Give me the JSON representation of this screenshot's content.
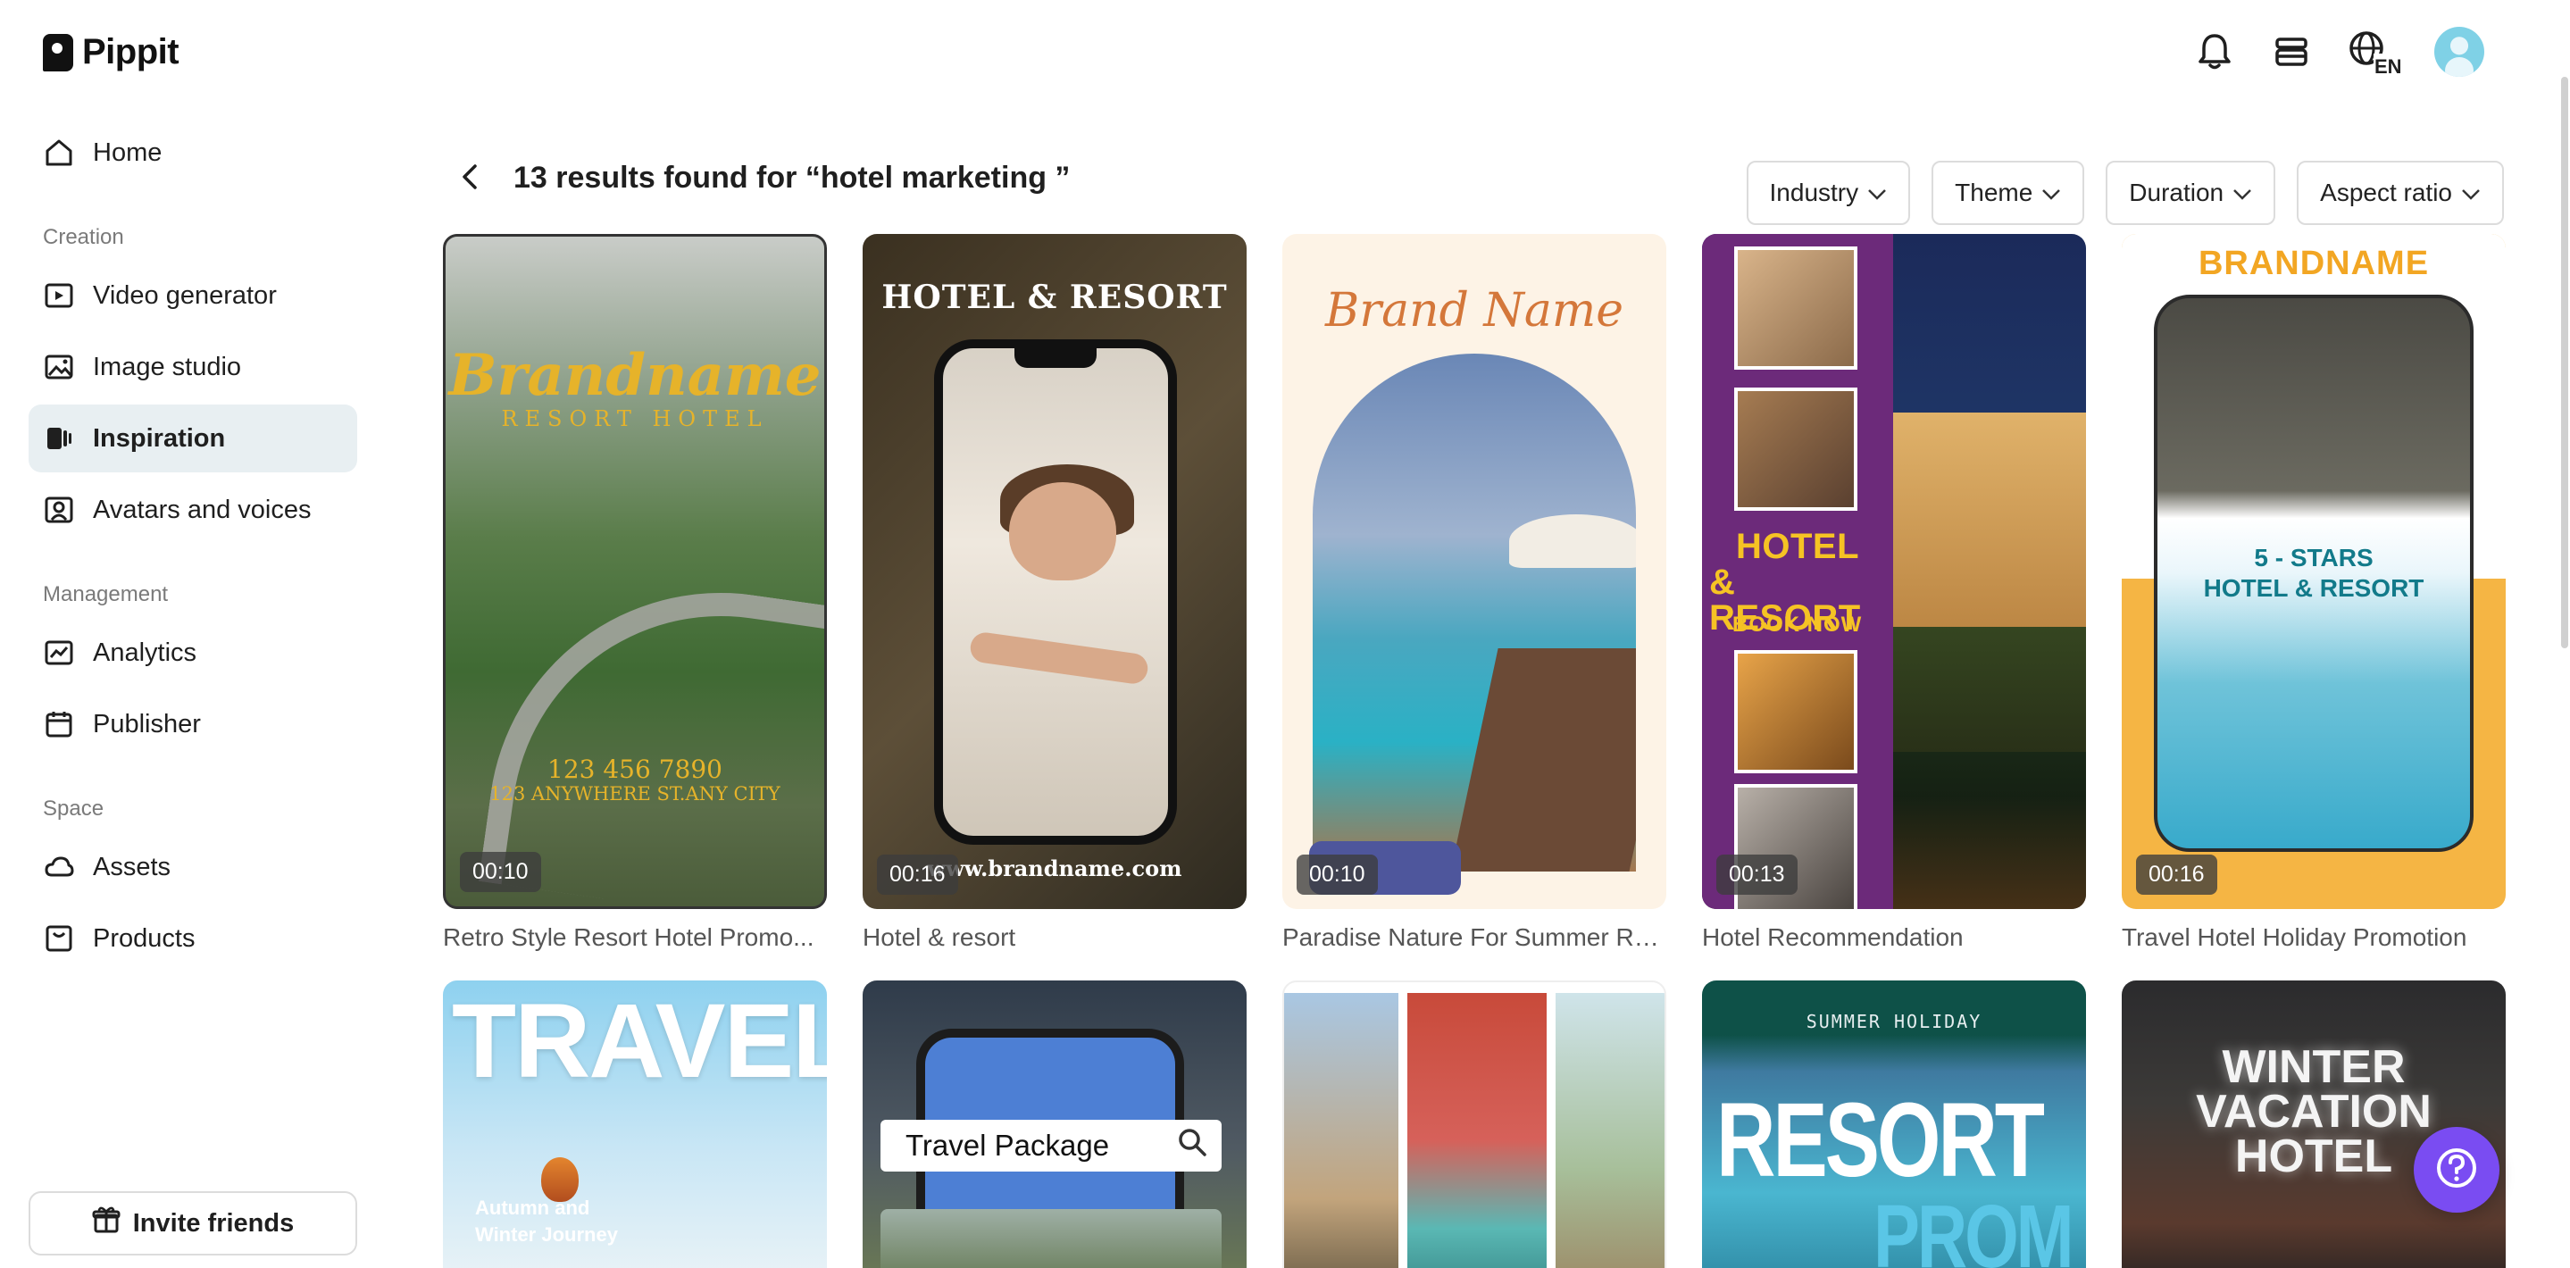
{
  "app": {
    "name": "Pippit"
  },
  "header": {
    "language": "EN"
  },
  "sidebar": {
    "home": "Home",
    "sections": {
      "creation": "Creation",
      "management": "Management",
      "space": "Space"
    },
    "items": [
      {
        "label": "Video generator",
        "icon": "video-generator-icon"
      },
      {
        "label": "Image studio",
        "icon": "image-studio-icon"
      },
      {
        "label": "Inspiration",
        "icon": "inspiration-icon",
        "active": true
      },
      {
        "label": "Avatars and voices",
        "icon": "avatar-icon"
      },
      {
        "label": "Analytics",
        "icon": "analytics-icon"
      },
      {
        "label": "Publisher",
        "icon": "calendar-icon"
      },
      {
        "label": "Assets",
        "icon": "cloud-icon"
      },
      {
        "label": "Products",
        "icon": "product-icon"
      }
    ],
    "invite": "Invite friends"
  },
  "results": {
    "title": "13 results found for “hotel marketing ”"
  },
  "filters": [
    "Industry",
    "Theme",
    "Duration",
    "Aspect ratio"
  ],
  "cards": [
    {
      "caption": "Retro Style Resort Hotel Promo...",
      "duration": "00:10",
      "overlay": {
        "brand": "Brandname",
        "sub": "RESORT HOTEL",
        "phone": "123 456 7890",
        "address": "123 ANYWHERE ST.ANY CITY"
      }
    },
    {
      "caption": "Hotel & resort",
      "duration": "00:16",
      "overlay": {
        "title": "HOTEL & RESORT",
        "url": "www.brandname.com"
      }
    },
    {
      "caption": "Paradise Nature For Summer Re...",
      "duration": "00:10",
      "overlay": {
        "brand": "Brand Name"
      }
    },
    {
      "caption": "Hotel Recommendation",
      "duration": "00:13",
      "overlay": {
        "title_line1": "HOTEL",
        "title_line2": "& RESORT",
        "cta": "BOOK NOW"
      }
    },
    {
      "caption": "Travel Hotel Holiday Promotion",
      "duration": "00:16",
      "overlay": {
        "brand": "BRANDNAME",
        "line1": "5 - STARS",
        "line2": "HOTEL & RESORT"
      }
    }
  ],
  "row2": [
    {
      "overlay": {
        "big": "TRAVEL",
        "sub1": "Autumn and",
        "sub2": "Winter Journey"
      }
    },
    {
      "overlay": {
        "search": "Travel Package"
      }
    },
    {
      "overlay": {}
    },
    {
      "overlay": {
        "top": "SUMMER HOLIDAY",
        "big": "RESORT",
        "small": "PROM"
      }
    },
    {
      "overlay": {
        "line1": "WINTER",
        "line2": "VACATION",
        "line3": "HOTEL"
      }
    }
  ]
}
